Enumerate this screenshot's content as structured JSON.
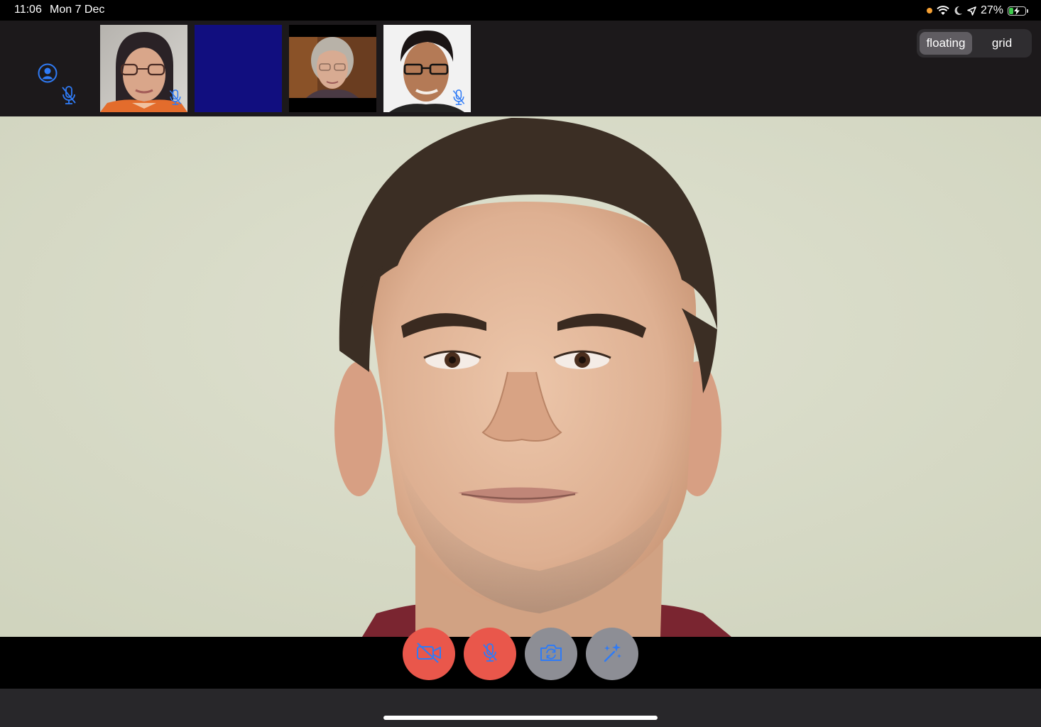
{
  "status_bar": {
    "time": "11:06",
    "date": "Mon 7 Dec",
    "battery_percent": "27%",
    "battery_level": 0.27,
    "icons": [
      "orange-dot-icon",
      "wifi-icon",
      "moon-icon",
      "location-arrow-icon",
      "battery-charging-icon"
    ]
  },
  "participants_strip": {
    "self": {
      "icons": [
        "person-circle-icon",
        "mic-slash-icon"
      ]
    },
    "tiles": [
      {
        "kind": "video",
        "muted": true
      },
      {
        "kind": "video-off",
        "muted": false
      },
      {
        "kind": "video",
        "muted": false
      },
      {
        "kind": "video",
        "muted": true
      }
    ]
  },
  "view_toggle": {
    "options": [
      "floating",
      "grid"
    ],
    "selected": "floating"
  },
  "controls": {
    "buttons": [
      {
        "name": "video-toggle",
        "icon": "video-slash-icon",
        "state": "off"
      },
      {
        "name": "mic-toggle",
        "icon": "mic-slash-icon",
        "state": "off"
      },
      {
        "name": "flip-camera",
        "icon": "camera-rotate-icon",
        "state": "neutral"
      },
      {
        "name": "effects",
        "icon": "sparkles-wand-icon",
        "state": "neutral"
      }
    ]
  },
  "colors": {
    "accent_blue": "#2f7bf6",
    "danger_red": "#e9574b",
    "neutral_gray": "#8d8e95",
    "strip_bg": "#1c191b",
    "video_off_tile": "#110e7f"
  }
}
